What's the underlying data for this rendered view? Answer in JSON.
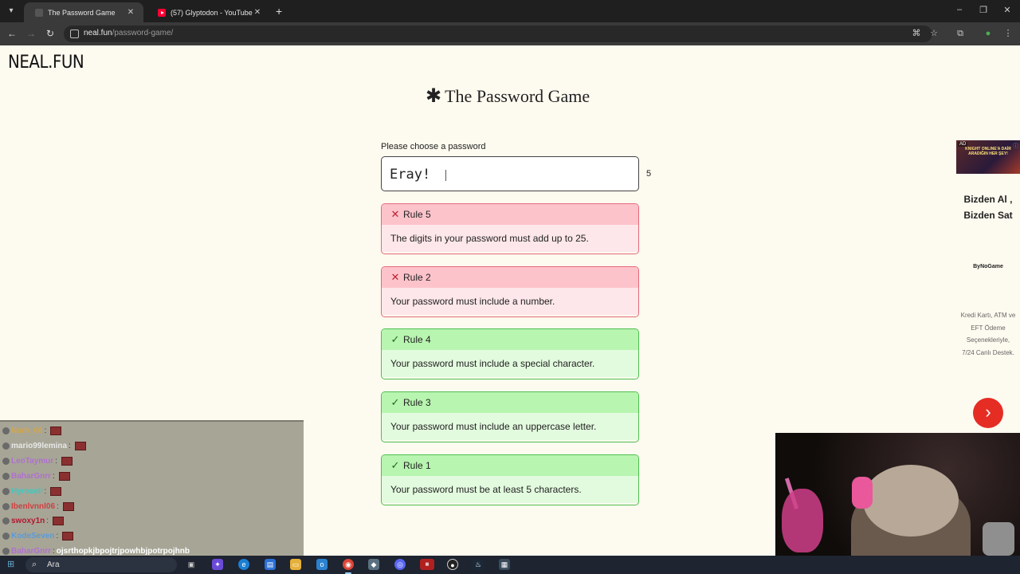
{
  "browser": {
    "tabs": [
      {
        "title": "The Password Game",
        "active": true
      },
      {
        "title": "(57) Glyptodon - YouTube",
        "active": false
      }
    ],
    "url_domain": "neal.fun",
    "url_path": "/password-game/"
  },
  "site": {
    "logo": "NEAL.FUN",
    "title_star": "✱",
    "title": "The Password Game"
  },
  "password": {
    "label": "Please choose a password",
    "value": "Eray!",
    "length": "5"
  },
  "rules": [
    {
      "label": "Rule 5",
      "text": "The digits in your password must add up to 25.",
      "status": "fail",
      "mark": "✕"
    },
    {
      "label": "Rule 2",
      "text": "Your password must include a number.",
      "status": "fail",
      "mark": "✕"
    },
    {
      "label": "Rule 4",
      "text": "Your password must include a special character.",
      "status": "pass",
      "mark": "✓"
    },
    {
      "label": "Rule 3",
      "text": "Your password must include an uppercase letter.",
      "status": "pass",
      "mark": "✓"
    },
    {
      "label": "Rule 1",
      "text": "Your password must be at least 5 characters.",
      "status": "pass",
      "mark": "✓"
    }
  ],
  "ad": {
    "badge": "AD",
    "image_text": "KNIGHT ONLINE'A DAİR ARADIĞIN HER ŞEY!",
    "headline": "Bizden Al , Bizden Sat",
    "brand": "ByNoGame",
    "body": "Kredi Kartı, ATM ve EFT Ödeme Seçenekleriyle, 7/24 Canlı Destek.",
    "arrow": "›"
  },
  "chat": [
    {
      "user": "Narh_06",
      "color": "#d4a64a",
      "message": ""
    },
    {
      "user": "mario99lemina",
      "color": "#e8e8e8",
      "message": ""
    },
    {
      "user": "LeoTaymur",
      "color": "#b070d0",
      "message": ""
    },
    {
      "user": "BaharGnrr",
      "color": "#b070d0",
      "message": ""
    },
    {
      "user": "Hyroxell",
      "color": "#40c8c0",
      "message": ""
    },
    {
      "user": "Ibenlvnnl06",
      "color": "#d04040",
      "message": ""
    },
    {
      "user": "swoxy1n",
      "color": "#b01830",
      "message": ""
    },
    {
      "user": "KodeSeven",
      "color": "#5a9ad8",
      "message": ""
    },
    {
      "user": "BaharGnrr",
      "color": "#b070d0",
      "message": "ojsrthopkjbpojtrjpowhbjpotrpojhnb"
    }
  ],
  "taskbar": {
    "search_placeholder": "Ara"
  },
  "colors": {
    "page_bg": "#fdfaef",
    "fail_header": "#fdc3cb",
    "pass_header": "#b8f5b0",
    "ad_arrow": "#e52d24"
  }
}
